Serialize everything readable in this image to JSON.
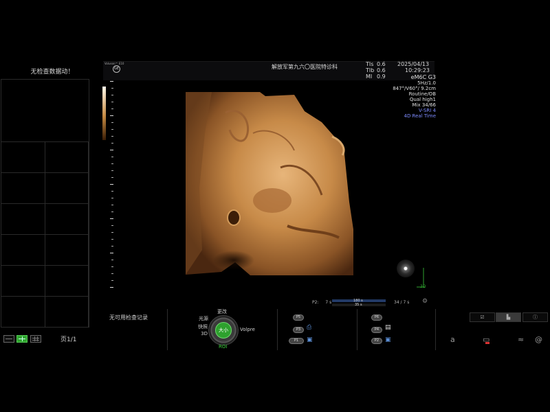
{
  "left_panel": {
    "message": "无检查数据动！",
    "page": "页1/1"
  },
  "header": {
    "logo_text": "Voluson™ E10",
    "ge_logo": "GE",
    "hospital": "解放军第九六〇医院特诊科",
    "tis_label": "TIs",
    "tis_value": "0.6",
    "tib_label": "TIb",
    "tib_value": "0.6",
    "mi_label": "MI",
    "mi_value": "0.9",
    "date": "2025/04/13",
    "time": "10:29:23"
  },
  "params": {
    "probe": "eM6C G3",
    "freq": "5Hz/1.0",
    "angle": "847°/V60°/ 9.2cm",
    "preset": "Routine/OB",
    "quality": "Qual high1",
    "mix": "Mix 34/66",
    "vsri": "V-SRI 4",
    "mode": "4D Real Time"
  },
  "orientation": {
    "axis_label": "3D"
  },
  "cine": {
    "p2_label": "P2:",
    "p2_value": "7 s",
    "bar_top": "180 s",
    "bar_bottom": "35 s",
    "frames": "34 / 7 s"
  },
  "bottom": {
    "no_record": "无可用检查记录",
    "knob": {
      "center": "大小",
      "top": "更改",
      "top_left": "光源",
      "left": "快照\n3D",
      "right": "Volpre",
      "bottom": "ROI"
    },
    "buttons_left": [
      "P5",
      "P3",
      "P1"
    ],
    "buttons_right": [
      "P6",
      "P4",
      "P2"
    ]
  },
  "colors": {
    "accent_green": "#2ea12e",
    "volume_tone": "#c88a45",
    "param_blue": "#7e8cff"
  },
  "icons": {
    "tools": [
      "checklist-icon",
      "bar-chart-icon",
      "info-icon"
    ],
    "system": [
      "text-a-icon",
      "monitor-icon",
      "network-icon",
      "at-icon"
    ]
  }
}
